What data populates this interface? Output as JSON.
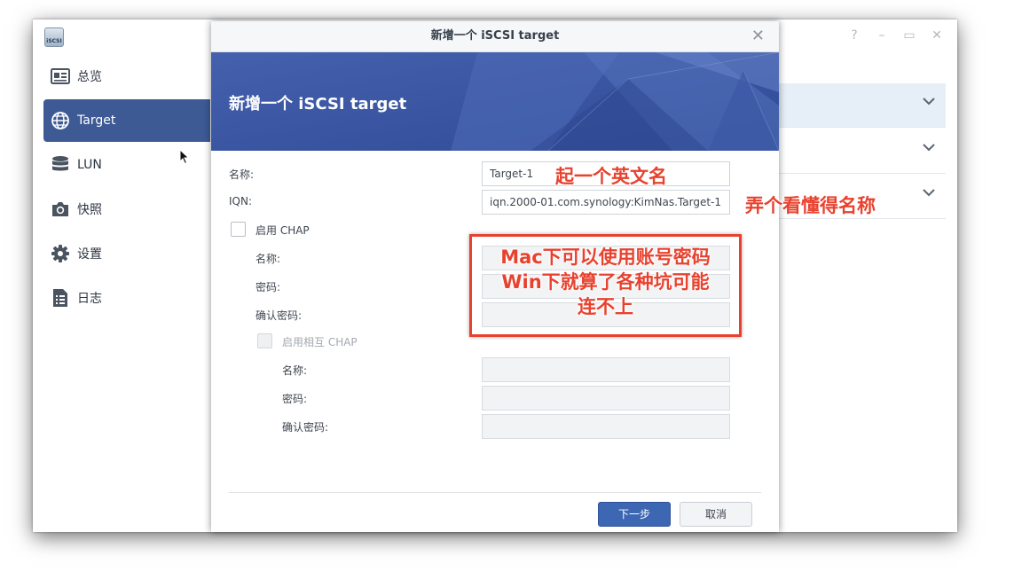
{
  "app": {
    "icon_label": "iSCSI",
    "controls": [
      "help-icon",
      "minimize-icon",
      "maximize-icon",
      "close-icon"
    ]
  },
  "sidebar": {
    "items": [
      {
        "label": "总览",
        "icon": "overview-card-icon"
      },
      {
        "label": "Target",
        "icon": "globe-icon",
        "active": true
      },
      {
        "label": "LUN",
        "icon": "database-icon"
      },
      {
        "label": "快照",
        "icon": "camera-icon"
      },
      {
        "label": "设置",
        "icon": "gear-icon"
      },
      {
        "label": "日志",
        "icon": "log-list-icon"
      }
    ]
  },
  "dialog": {
    "window_title": "新增一个 iSCSI target",
    "banner_title": "新增一个 iSCSI target",
    "name_label": "名称:",
    "name_value": "Target-1",
    "iqn_label": "IQN:",
    "iqn_value": "iqn.2000-01.com.synology:KimNas.Target-1",
    "chap_label": "启用 CHAP",
    "chap_name_label": "名称:",
    "chap_password_label": "密码:",
    "chap_confirm_label": "确认密码:",
    "mutual_chap_label": "启用相互 CHAP",
    "mutual_name_label": "名称:",
    "mutual_password_label": "密码:",
    "mutual_confirm_label": "确认密码:",
    "next_button": "下一步",
    "cancel_button": "取消"
  },
  "annotations": {
    "name_note": "起一个英文名",
    "iqn_note": "弄个看懂得名称",
    "chap_note_lines": [
      "Mac下可以使用账号密码",
      "Win下就算了各种坑可能",
      "连不上"
    ]
  },
  "colors": {
    "sidebar_active": "#3d5a94",
    "banner": "#3c59a7",
    "primary_button": "#3d67b3",
    "annotation": "#e8422f"
  }
}
